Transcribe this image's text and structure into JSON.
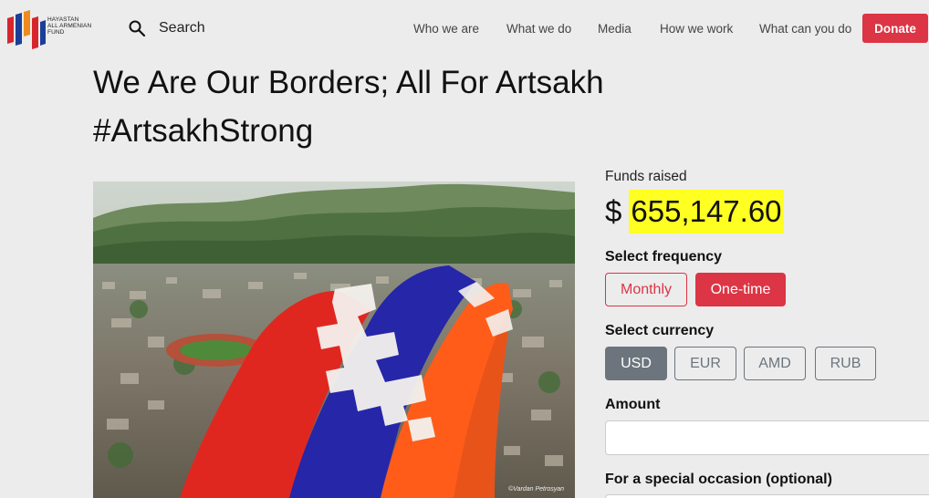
{
  "brand": {
    "logo_lines": [
      "HAYASTAN",
      "ALL ARMENIAN",
      "FUND"
    ],
    "colors": [
      "#d7262b",
      "#1b3f96",
      "#f08a1e"
    ]
  },
  "search": {
    "label": "Search",
    "icon": "search-icon"
  },
  "nav": {
    "items": [
      "Who we are",
      "What we do",
      "Media",
      "How we work",
      "What can you do"
    ],
    "donate_label": "Donate"
  },
  "page": {
    "title_line1": "We Are Our Borders; All For Artsakh",
    "title_line2": "#ArtsakhStrong"
  },
  "hero": {
    "credit": "©Vardan Petrosyan"
  },
  "donation": {
    "funds_label": "Funds raised",
    "currency_symbol": "$",
    "funds_amount": "655,147.60",
    "frequency_label": "Select frequency",
    "frequency_options": [
      "Monthly",
      "One-time"
    ],
    "frequency_selected": "One-time",
    "currency_label": "Select currency",
    "currency_options": [
      "USD",
      "EUR",
      "AMD",
      "RUB"
    ],
    "currency_selected": "USD",
    "amount_label": "Amount",
    "amount_value": "",
    "occasion_label": "For a special occasion (optional)"
  },
  "colors": {
    "accent": "#dc3545",
    "highlight": "#ffff22",
    "selected_grey": "#6c757d"
  }
}
